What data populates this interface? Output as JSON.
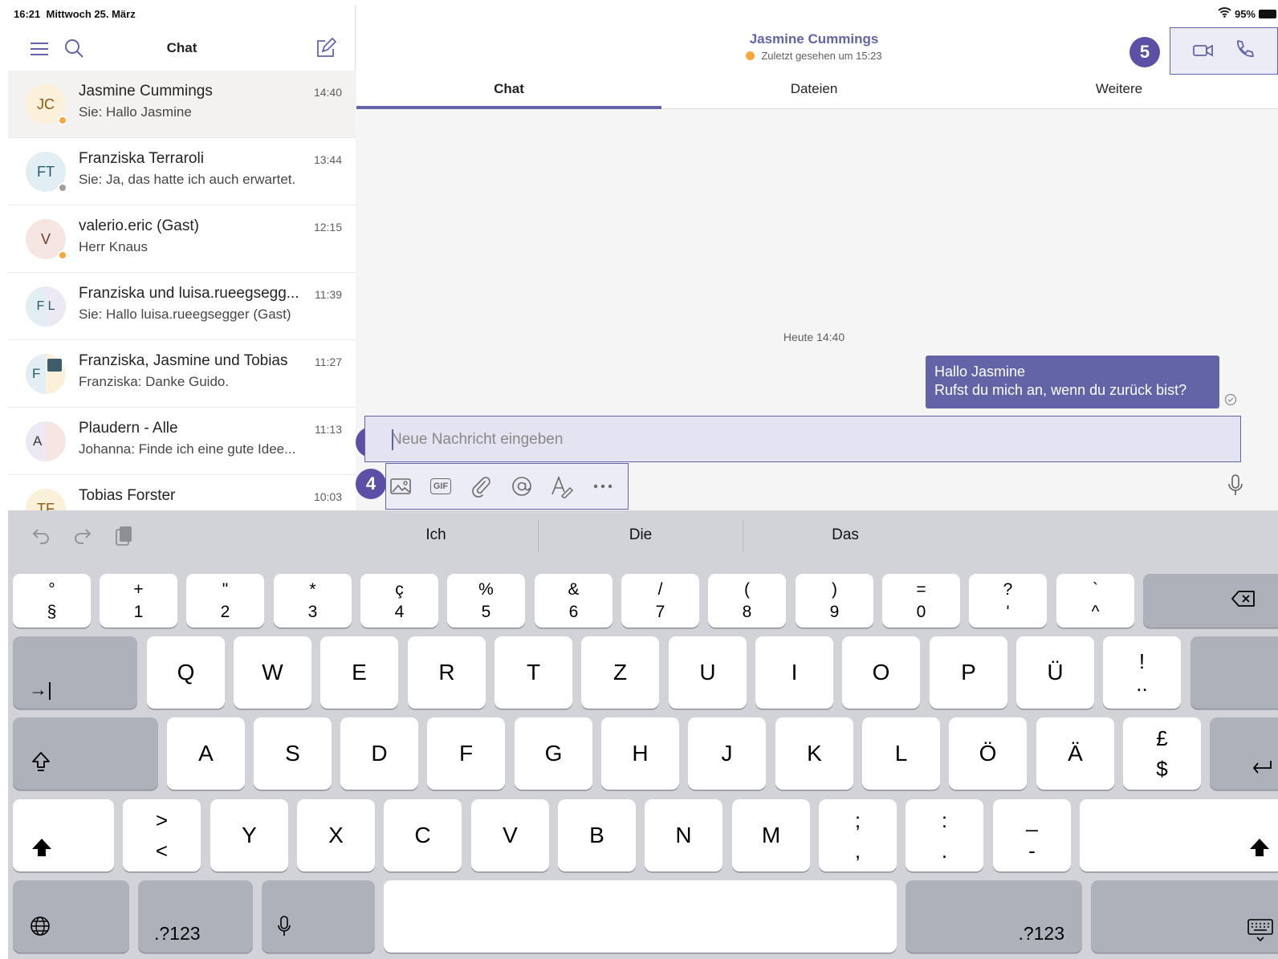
{
  "status_bar": {
    "time": "16:21",
    "date": "Mittwoch 25. März",
    "battery": "95%"
  },
  "sidebar": {
    "title": "Chat",
    "chats": [
      {
        "initials": "JC",
        "name": "Jasmine Cummings",
        "preview": "Sie: Hallo Jasmine",
        "time": "14:40",
        "avatar_color": "#fbf0d9",
        "presence_color": "#f8a73b",
        "active": true
      },
      {
        "initials": "FT",
        "name": "Franziska Terraroli",
        "preview": "Sie: Ja, das hatte ich auch erwartet.",
        "time": "13:44",
        "avatar_color": "#e1eef4",
        "presence_color": "#a19f9d"
      },
      {
        "initials": "V",
        "name": "valerio.eric (Gast)",
        "preview": "Herr Knaus",
        "time": "12:15",
        "avatar_color": "#f6e6e2",
        "presence_color": "#f8a73b"
      },
      {
        "initials": "F L",
        "name": "Franziska und luisa.rueegsegg...",
        "preview": "Sie: Hallo luisa.rueegsegger (Gast)",
        "time": "11:39",
        "avatar_color": "#e4e6f4"
      },
      {
        "initials": "F",
        "name": "Franziska, Jasmine und Tobias",
        "preview": "Franziska: Danke Guido.",
        "time": "11:27",
        "avatar_color": "#e1eef4"
      },
      {
        "initials": "A",
        "name": "Plaudern - Alle",
        "preview": "Johanna: Finde ich eine gute Idee...",
        "time": "11:13",
        "avatar_color": "#ece8f4"
      },
      {
        "initials": "TF",
        "name": "Tobias  Forster",
        "preview": "",
        "time": "10:03",
        "avatar_color": "#fbf0d9"
      }
    ]
  },
  "conversation": {
    "name": "Jasmine Cummings",
    "last_seen": "Zuletzt gesehen um 15:23",
    "tabs": [
      "Chat",
      "Dateien",
      "Weitere"
    ],
    "active_tab": "Chat",
    "date_divider": "Heute 14:40",
    "message_line1": "Hallo Jasmine",
    "message_line2": "Rufst du mich an, wenn du zurück bist?",
    "compose_placeholder": "Neue Nachricht eingeben",
    "toolbar_icons": [
      "image-icon",
      "gif-icon",
      "attach-icon",
      "mention-icon",
      "format-icon",
      "more-icon"
    ],
    "gif_label": "GIF"
  },
  "callouts": {
    "compose": "3",
    "toolbar": "4",
    "call": "5"
  },
  "keyboard": {
    "suggestions": [
      "Ich",
      "Die",
      "Das"
    ],
    "number_row": [
      {
        "top": "°",
        "bottom": "§"
      },
      {
        "top": "+",
        "bottom": "1"
      },
      {
        "top": "\"",
        "bottom": "2"
      },
      {
        "top": "*",
        "bottom": "3"
      },
      {
        "top": "ç",
        "bottom": "4"
      },
      {
        "top": "%",
        "bottom": "5"
      },
      {
        "top": "&",
        "bottom": "6"
      },
      {
        "top": "/",
        "bottom": "7"
      },
      {
        "top": "(",
        "bottom": "8"
      },
      {
        "top": ")",
        "bottom": "9"
      },
      {
        "top": "=",
        "bottom": "0"
      },
      {
        "top": "?",
        "bottom": "'"
      },
      {
        "top": "`",
        "bottom": "^"
      }
    ],
    "row_q": [
      "Q",
      "W",
      "E",
      "R",
      "T",
      "Z",
      "U",
      "I",
      "O",
      "P",
      "Ü"
    ],
    "row_q_extra": {
      "top": "!",
      "bottom": ".."
    },
    "row_a": [
      "A",
      "S",
      "D",
      "F",
      "G",
      "H",
      "J",
      "K",
      "L",
      "Ö",
      "Ä"
    ],
    "row_a_extra": {
      "top": "£",
      "bottom": "$"
    },
    "row_y_first": {
      "top": ">",
      "bottom": "<"
    },
    "row_y": [
      "Y",
      "X",
      "C",
      "V",
      "B",
      "N",
      "M"
    ],
    "row_y_extra": [
      {
        "top": ";",
        "bottom": ","
      },
      {
        "top": ":",
        "bottom": "."
      },
      {
        "top": "_",
        "bottom": "-"
      }
    ],
    "numbers_key": ".?123",
    "tab_symbol": "→|"
  },
  "colors": {
    "accent": "#6264a7",
    "callout": "#5b4fa6",
    "keyboard_bg": "#d1d3d9"
  }
}
